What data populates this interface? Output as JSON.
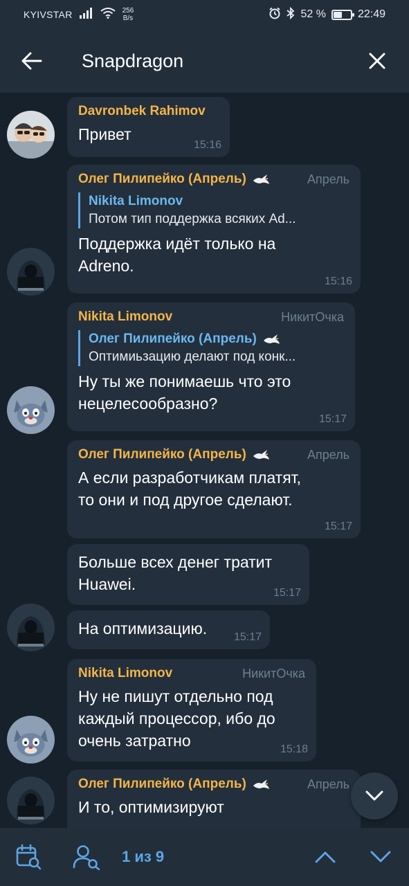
{
  "status_bar": {
    "carrier": "KYIVSTAR",
    "net_speed_value": "256",
    "net_speed_unit": "B/s",
    "battery_percent": "52 %",
    "battery_level": 0.52,
    "time": "22:49"
  },
  "header": {
    "title": "Snapdragon"
  },
  "messages": [
    {
      "sender": "Davronbek Rahimov",
      "text": "Привет",
      "time": "15:16"
    },
    {
      "sender": "Олег Пилипейко (Апрель)",
      "badge": "Апрель",
      "reply_name": "Nikita Limonov",
      "reply_text": "Потом тип поддержка всяких Ad...",
      "text": "Поддержка идёт только на\nAdreno.",
      "time": "15:16"
    },
    {
      "sender": "Nikita Limonov",
      "badge": "НикитОчка",
      "reply_name": "Олег Пилипейко (Апрель)",
      "reply_text": "Оптимиьзацию делают под конк...",
      "text": "Ну ты же понимаешь что это\nнецелесообразно?",
      "time": "15:17"
    },
    {
      "sender": "Олег Пилипейко (Апрель)",
      "badge": "Апрель",
      "text": "А если разработчикам платят,\nто они и под другое сделают.",
      "time": "15:17"
    },
    {
      "text": "Больше всех денег тратит\nHuawei.",
      "time": "15:17"
    },
    {
      "text": "На оптимизацию.",
      "time": "15:17"
    },
    {
      "sender": "Nikita Limonov",
      "badge": "НикитОчка",
      "text": "Ну не пишут отдельно под\nкаждый процессор, ибо до\nочень затратно",
      "time": "15:18"
    },
    {
      "sender": "Олег Пилипейко (Апрель)",
      "badge": "Апрель",
      "text": "И то, оптимизируют"
    }
  ],
  "search_bar": {
    "calendar_icon": "calendar-search-icon",
    "user_icon": "user-search-icon",
    "counter": "1 из 9"
  },
  "colors": {
    "background": "#17212b",
    "bar": "#222e3a",
    "bubble": "#232f3c",
    "sender_name": "#f4b548",
    "reply_accent": "#5ea5e6",
    "muted": "#6d7f8f"
  }
}
